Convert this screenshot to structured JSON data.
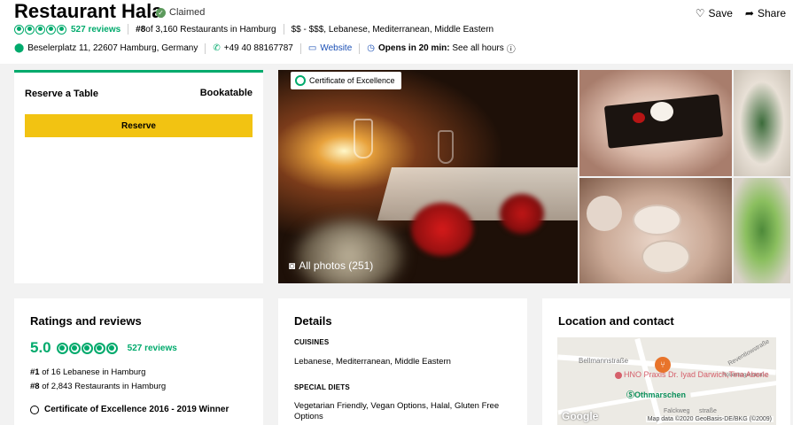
{
  "header": {
    "title": "Restaurant Hala",
    "claimed": "Claimed",
    "save": "Save",
    "share": "Share",
    "reviews_link": "527 reviews",
    "rank_prefix": "#8",
    "rank_text": " of 3,160 Restaurants in Hamburg",
    "price_cuisine": "$$ - $$$, Lebanese, Mediterranean, Middle Eastern",
    "address": "Beselerplatz 11, 22607 Hamburg, Germany",
    "phone": "+49 40 88167787",
    "website": "Website",
    "opens": "Opens in 20 min:",
    "hours": "See all hours"
  },
  "rating_bubbles": 5,
  "reserve": {
    "label": "Reserve a Table",
    "bookatable": "Bookatable",
    "button": "Reserve"
  },
  "photos": {
    "badge": "Certificate of Excellence",
    "all_photos": "All photos (251)"
  },
  "ratings": {
    "title": "Ratings and reviews",
    "score": "5.0",
    "reviews": "527 reviews",
    "rank1_num": "#1",
    "rank1_text": " of 16 Lebanese in Hamburg",
    "rank2_num": "#8",
    "rank2_text": " of 2,843 Restaurants in Hamburg",
    "certificate": "Certificate of Excellence 2016 - 2019 Winner"
  },
  "details": {
    "title": "Details",
    "cuisines_label": "CUISINES",
    "cuisines": "Lebanese, Mediterranean, Middle Eastern",
    "diets_label": "SPECIAL DIETS",
    "diets": "Vegetarian Friendly, Vegan Options, Halal, Gluten Free Options"
  },
  "location": {
    "title": "Location and contact",
    "map_street1": "Bellmannstraße",
    "map_street2": "Reventlowstraße",
    "map_street3": "Rosenhagenstraße",
    "map_street4": "Falckweg",
    "map_street5": "straße",
    "poi": "HNO Praxis Dr. Iyad Darwich,Tina Aberle",
    "station": "Othmarschen",
    "google": "Google",
    "attribution": "Map data ©2020 GeoBasis-DE/BKG (©2009)"
  },
  "colors": {
    "accent": "#00aa6c",
    "reserve_button": "#f2c312",
    "link": "#1a4fb5"
  }
}
